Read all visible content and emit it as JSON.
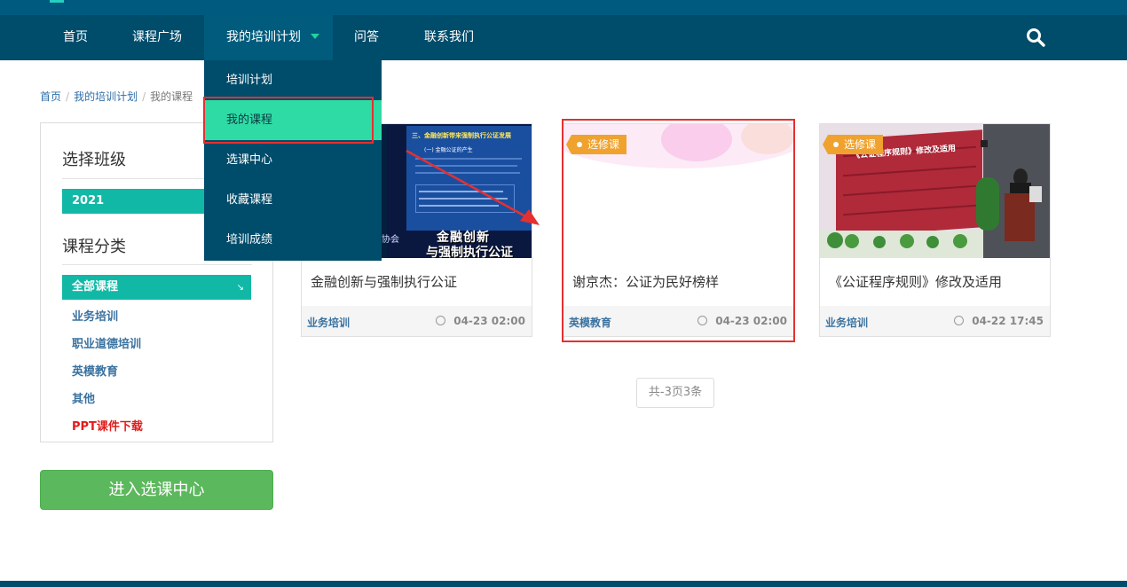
{
  "nav": {
    "items": [
      "首页",
      "课程广场",
      "我的培训计划",
      "问答",
      "联系我们"
    ]
  },
  "dropdown": {
    "items": [
      "培训计划",
      "我的课程",
      "选课中心",
      "收藏课程",
      "培训成绩"
    ]
  },
  "breadcrumb": [
    "首页",
    "我的培训计划",
    "我的课程"
  ],
  "sidebar": {
    "class_heading": "选择班级",
    "class_selected": "2021",
    "category_heading": "课程分类",
    "category_selected": "全部课程",
    "categories": [
      "业务培训",
      "职业道德培训",
      "英模教育",
      "其他",
      "PPT课件下载"
    ]
  },
  "enter_button": "进入选课中心",
  "courses": [
    {
      "title": "金融创新与强制执行公证",
      "category": "业务培训",
      "time": "04-23 02:00",
      "tag": "",
      "thumb": {
        "slide_title": "三、金融创新带来强制执行公证发展",
        "subtitle": "(一) 金融公证的产生",
        "big_text_line1": "金融创新",
        "big_text_line2": "与强制执行公证",
        "org": "协会"
      }
    },
    {
      "title": "谢京杰：公证为民好榜样",
      "category": "英模教育",
      "time": "04-23 02:00",
      "tag": "选修课",
      "thumb": {}
    },
    {
      "title": "《公证程序规则》修改及适用",
      "category": "业务培训",
      "time": "04-22 17:45",
      "tag": "选修课",
      "thumb": {
        "banner": "《公证程序规则》修改及适用"
      }
    }
  ],
  "pager": "共-3页3条",
  "colors": {
    "nav_bg": "#004c6b",
    "accent": "#12b8a6",
    "highlight": "#2fdba5",
    "tag": "#f0a22e",
    "annotation": "#e53030",
    "button": "#5cb85c"
  }
}
